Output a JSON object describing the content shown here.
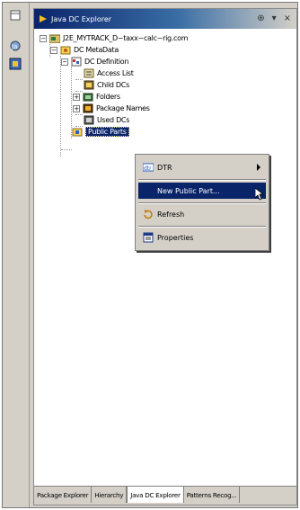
{
  "view": {
    "title": "Java DC Explorer"
  },
  "tree": {
    "root": "J2E_MYTRACK_D~taxx~calc~rig.com",
    "dc_metadata": "DC MetaData",
    "dc_definition": "DC Definition",
    "access_list": "Access List",
    "child_dcs": "Child DCs",
    "folders": "Folders",
    "package_names": "Package Names",
    "used_dcs": "Used DCs",
    "public_parts": "Public Parts"
  },
  "context_menu": {
    "dtr": "DTR",
    "new_public_part": "New Public Part...",
    "refresh": "Refresh",
    "properties": "Properties"
  },
  "bottom_tabs": [
    "Package Explorer",
    "Hierarchy",
    "Java DC Explorer",
    "Patterns Recog..."
  ],
  "colors": {
    "title_bar": "#0a246a",
    "selection": "#0a246a",
    "chrome": "#d4d0c8"
  }
}
